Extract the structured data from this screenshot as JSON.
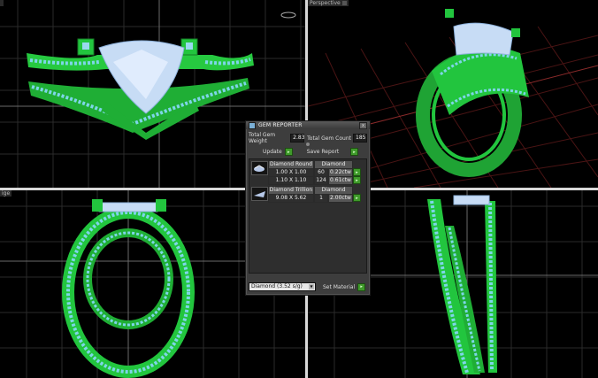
{
  "viewports": {
    "top_left": {
      "label": ""
    },
    "top_right": {
      "label": "Perspective"
    },
    "bottom_left": {
      "label": "ige"
    },
    "bottom_right": {
      "label": ""
    }
  },
  "gem_reporter": {
    "title": "GEM REPORTER",
    "close_glyph": "x",
    "total_weight_label": "Total Gem Weight",
    "total_weight_value": "2.83",
    "total_count_label": "Total Gem Count",
    "total_count_value": "185",
    "update_label": "Update",
    "save_report_label": "Save Report",
    "gems": [
      {
        "name": "Diamond Round",
        "material": "Diamond",
        "sizes": [
          {
            "size": "1.00 X 1.00",
            "count": "60",
            "weight": "0.22ctw"
          },
          {
            "size": "1.10 X 1.10",
            "count": "124",
            "weight": "0.61ctw"
          }
        ]
      },
      {
        "name": "Diamond Trillion",
        "material": "Diamond",
        "sizes": [
          {
            "size": "9.08 X 5.62",
            "count": "1",
            "weight": "2.00ctw"
          }
        ]
      }
    ],
    "material_select": "Diamond     (3.52 s/g)",
    "set_material_label": "Set Material"
  },
  "colors": {
    "metal": "#22c53e",
    "gem_small": "#7ed6e8",
    "gem_main": "#c7dcf5",
    "grid_red": "#5a1a1a",
    "grid_gray": "#2c2c2c"
  },
  "icons": [
    "viewport-menu-icon",
    "gem-reporter-logo-icon",
    "close-icon",
    "arrow-icon",
    "gem-thumbnail-icon",
    "dropdown-arrow-icon"
  ]
}
